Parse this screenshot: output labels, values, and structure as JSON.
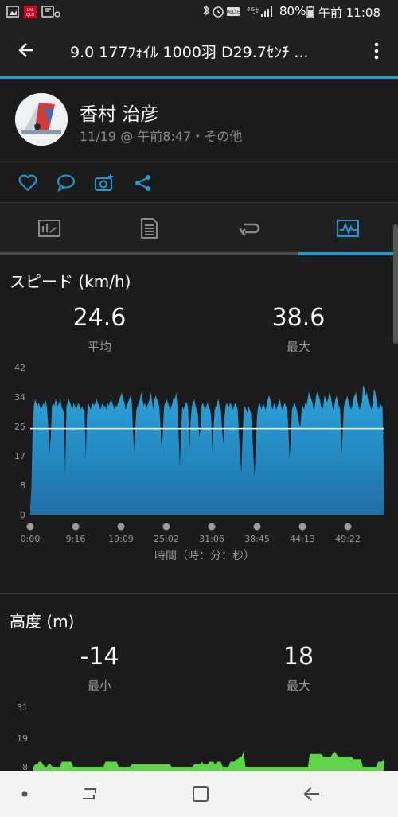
{
  "status_bar": {
    "battery": "80%",
    "time": "午前 11:08",
    "network": "4G+"
  },
  "app_bar": {
    "title": "9.0  177ﾌｫｲﾙ   1000羽    D29.7ｾﾝﾁ ..."
  },
  "profile": {
    "name": "香村 治彦",
    "subtitle": "11/19 @ 午前8:47・その他"
  },
  "actions": {
    "icons": [
      "heart-icon",
      "comment-icon",
      "camera-add-icon",
      "share-icon"
    ]
  },
  "tabs": {
    "icons": [
      "summary-icon",
      "details-icon",
      "laps-icon",
      "chart-icon"
    ],
    "active_index": 3
  },
  "speed": {
    "title": "スピード (km/h)",
    "avg_value": "24.6",
    "avg_label": "平均",
    "max_value": "38.6",
    "max_label": "最大",
    "xlabel": "時間（時：分：秒）"
  },
  "altitude": {
    "title": "高度 (m)",
    "min_value": "-14",
    "min_label": "最小",
    "max_value": "18",
    "max_label": "最大"
  },
  "colors": {
    "accent": "#1e9bd7",
    "speed_fill_top": "#2aa6dc",
    "speed_fill_bottom": "#1f6fa8",
    "altitude_fill": "#5fd34a",
    "average_line": "#ffffff"
  },
  "chart_data": [
    {
      "type": "area",
      "series": [
        {
          "values": [
            2,
            8,
            24,
            31,
            33,
            32,
            31,
            32,
            31,
            30,
            31,
            32,
            31,
            33,
            30,
            25,
            18,
            22,
            31,
            32,
            31,
            33,
            32,
            31,
            32,
            33,
            31,
            30,
            29,
            11,
            31,
            32,
            33,
            32,
            31,
            30,
            32,
            31,
            30,
            31,
            32,
            31,
            30,
            31,
            30,
            30,
            16,
            28,
            32,
            31,
            30,
            31,
            32,
            31,
            32,
            33,
            32,
            31,
            30,
            31,
            32,
            31,
            31,
            30,
            32,
            31,
            32,
            33,
            32,
            31,
            30,
            31,
            31,
            32,
            33,
            34,
            35,
            33,
            32,
            30,
            31,
            32,
            33,
            34,
            33,
            26,
            18,
            24,
            30,
            31,
            32,
            33,
            35,
            33,
            31,
            32,
            30,
            31,
            32,
            33,
            35,
            32,
            30,
            33,
            34,
            33,
            32,
            31,
            25,
            18,
            24,
            31,
            32,
            33,
            32,
            31,
            30,
            31,
            32,
            34,
            33,
            35,
            31,
            23,
            14,
            22,
            31,
            30,
            31,
            32,
            32,
            30,
            18,
            27,
            31,
            32,
            33,
            31,
            30,
            29,
            22,
            24,
            31,
            32,
            31,
            30,
            31,
            32,
            31,
            30,
            28,
            18,
            25,
            30,
            31,
            32,
            33,
            31,
            30,
            25,
            20,
            28,
            31,
            32,
            31,
            31,
            32,
            31,
            30,
            31,
            32,
            31,
            30,
            23,
            17,
            12,
            22,
            30,
            31,
            30,
            29,
            31,
            30,
            29,
            24,
            17,
            11,
            20,
            28,
            31,
            32,
            31,
            30,
            32,
            31,
            30,
            31,
            33,
            34,
            33,
            31,
            30,
            32,
            31,
            30,
            31,
            32,
            33,
            31,
            30,
            31,
            32,
            31,
            30,
            25,
            16,
            22,
            30,
            31,
            32,
            31,
            30,
            28,
            26,
            25,
            30,
            31,
            30,
            32,
            31,
            33,
            35,
            34,
            33,
            32,
            30,
            31,
            34,
            35,
            34,
            33,
            31,
            30,
            31,
            34,
            33,
            32,
            33,
            35,
            34,
            32,
            30,
            31,
            33,
            34,
            32,
            31,
            30,
            17,
            23,
            31,
            32,
            33,
            34,
            32,
            31,
            30,
            31,
            33,
            34,
            35,
            33,
            31,
            30,
            31,
            32,
            37,
            36,
            34,
            35,
            33,
            32,
            31,
            30,
            32,
            36,
            35,
            33,
            31,
            30,
            32,
            31,
            31,
            16
          ]
        }
      ],
      "x_tick_labels": [
        "0:00",
        "9:16",
        "19:09",
        "25:02",
        "31:06",
        "38:45",
        "44:13",
        "49:22"
      ],
      "y_tick_labels": [
        "0",
        "8",
        "17",
        "25",
        "34",
        "42"
      ],
      "ylim": [
        0,
        42
      ],
      "average": 24.6,
      "xlabel": "時間（時：分：秒）"
    },
    {
      "type": "area",
      "series": [
        {
          "values": [
            8,
            9,
            9,
            10,
            10,
            9,
            8,
            8,
            9,
            9,
            8,
            8,
            8,
            8,
            8,
            10,
            10,
            10,
            10,
            10,
            10,
            8,
            8,
            8,
            8,
            8,
            8,
            8,
            8,
            8,
            8,
            8,
            8,
            8,
            8,
            8,
            8,
            8,
            10,
            10,
            10,
            10,
            10,
            10,
            10,
            8,
            8,
            8,
            8,
            8,
            8,
            8,
            9,
            9,
            9,
            9,
            9,
            9,
            9,
            9,
            9,
            9,
            9,
            9,
            9,
            9,
            9,
            9,
            9,
            9,
            9,
            9,
            9,
            8,
            8,
            8,
            8,
            8,
            8,
            8,
            8,
            8,
            8,
            8,
            8,
            9,
            9,
            9,
            9,
            10,
            9,
            9,
            9,
            10,
            10,
            10,
            9,
            10,
            10,
            10,
            8,
            8,
            8,
            8,
            10,
            10,
            10,
            11,
            11,
            12,
            12,
            14,
            8,
            8,
            8,
            8,
            8,
            8,
            8,
            8,
            8,
            8,
            8,
            8,
            8,
            8,
            8,
            8,
            8,
            8,
            8,
            8,
            8,
            8,
            8,
            8,
            8,
            8,
            8,
            8,
            8,
            8,
            8,
            8,
            8,
            8,
            13,
            13,
            13,
            13,
            13,
            13,
            13,
            12,
            12,
            12,
            12,
            12,
            13,
            14,
            13,
            12,
            12,
            12,
            12,
            12,
            12,
            12,
            12,
            11,
            11,
            11,
            11,
            11,
            8,
            8,
            8,
            8,
            8,
            8,
            8,
            8,
            10,
            10,
            10,
            11
          ]
        }
      ],
      "y_tick_labels": [
        "8",
        "19",
        "31"
      ],
      "ylim": [
        -14,
        31
      ]
    }
  ]
}
